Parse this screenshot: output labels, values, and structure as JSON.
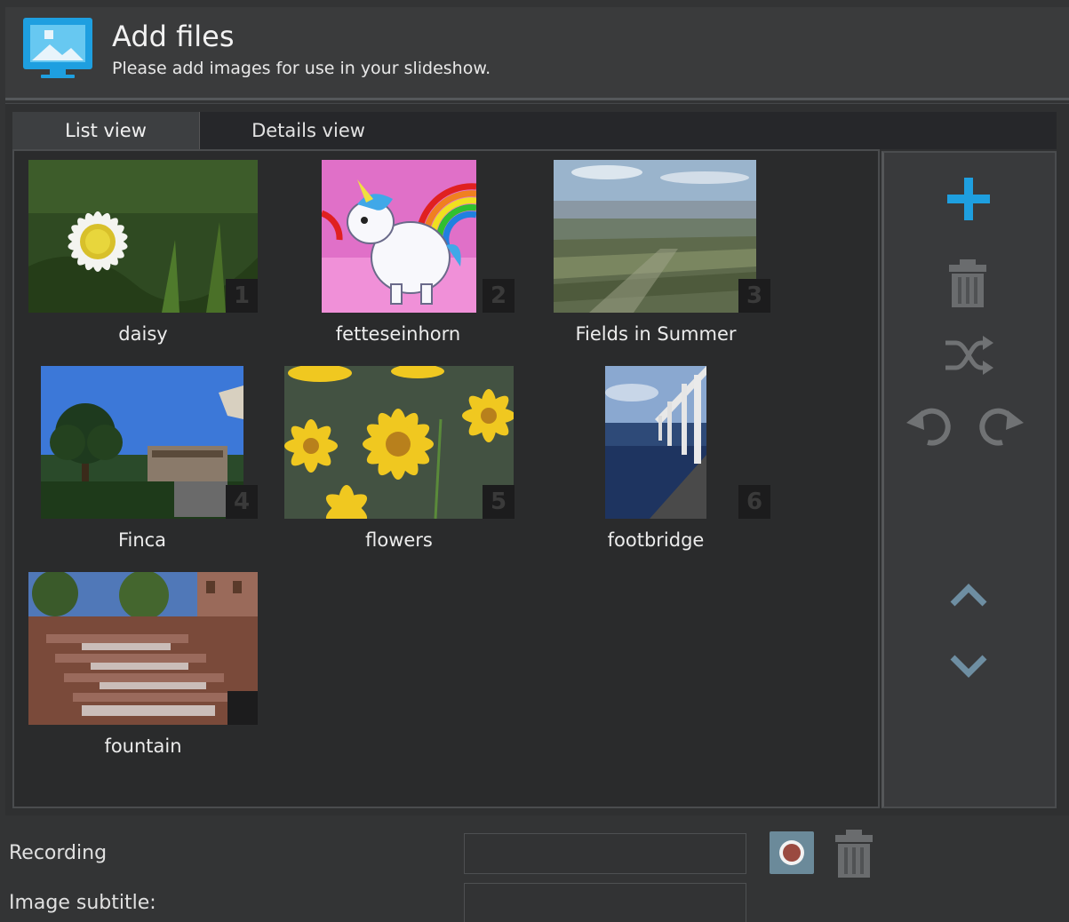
{
  "header": {
    "title": "Add files",
    "subtitle": "Please add images for use in your slideshow."
  },
  "tabs": [
    {
      "label": "List view",
      "active": true
    },
    {
      "label": "Details view",
      "active": false
    }
  ],
  "images": [
    {
      "name": "daisy",
      "index": "1"
    },
    {
      "name": "fetteseinhorn",
      "index": "2"
    },
    {
      "name": "Fields in Summer",
      "index": "3"
    },
    {
      "name": "Finca",
      "index": "4"
    },
    {
      "name": "flowers",
      "index": "5"
    },
    {
      "name": "footbridge",
      "index": "6"
    },
    {
      "name": "fountain",
      "index": ""
    }
  ],
  "sidebar": {
    "icons": [
      "add-icon",
      "trash-icon",
      "shuffle-icon",
      "rotate-left-icon",
      "rotate-right-icon",
      "move-up-icon",
      "move-down-icon"
    ]
  },
  "bottom": {
    "recording_label": "Recording",
    "subtitle_label": "Image subtitle:",
    "recording_value": "",
    "subtitle_value": ""
  },
  "colors": {
    "accent": "#1e9fe0",
    "background": "#333435",
    "panel": "#2a2b2c"
  }
}
